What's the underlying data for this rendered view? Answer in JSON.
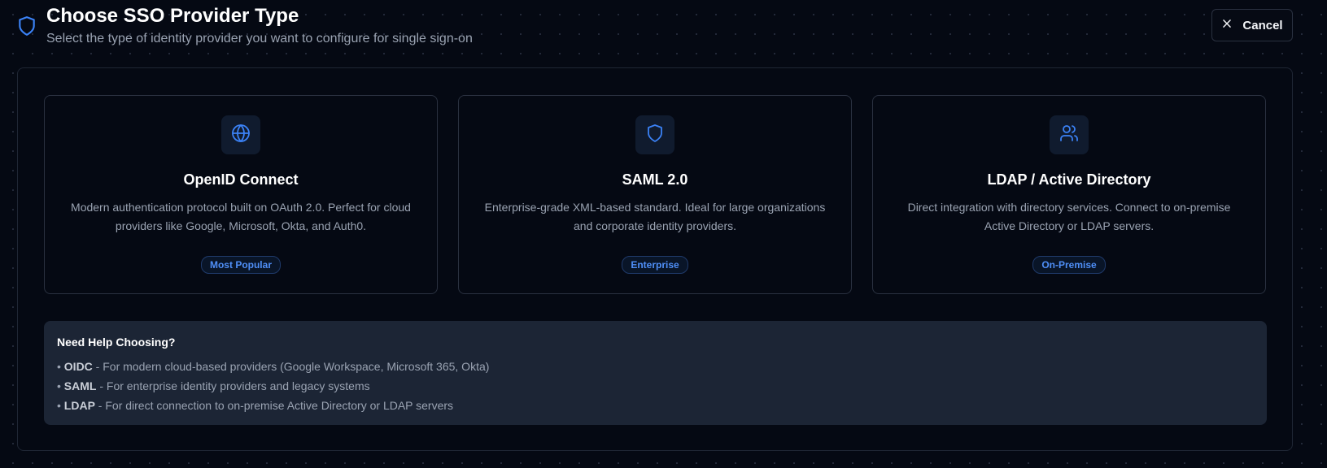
{
  "header": {
    "title": "Choose SSO Provider Type",
    "subtitle": "Select the type of identity provider you want to configure for single sign-on",
    "icon": "shield-icon",
    "cancel_label": "Cancel"
  },
  "providers": [
    {
      "icon": "globe-icon",
      "title": "OpenID Connect",
      "description": "Modern authentication protocol built on OAuth 2.0. Perfect for cloud providers like Google, Microsoft, Okta, and Auth0.",
      "badge": "Most Popular"
    },
    {
      "icon": "shield-icon",
      "title": "SAML 2.0",
      "description": "Enterprise-grade XML-based standard. Ideal for large organizations and corporate identity providers.",
      "badge": "Enterprise"
    },
    {
      "icon": "users-icon",
      "title": "LDAP / Active Directory",
      "description": "Direct integration with directory services. Connect to on-premise Active Directory or LDAP servers.",
      "badge": "On-Premise"
    }
  ],
  "help": {
    "title": "Need Help Choosing?",
    "bullet": "•",
    "items": [
      {
        "term": "OIDC",
        "text": " - For modern cloud-based providers (Google Workspace, Microsoft 365, Okta)"
      },
      {
        "term": "SAML",
        "text": " - For enterprise identity providers and legacy systems"
      },
      {
        "term": "LDAP",
        "text": " - For direct connection to on-premise Active Directory or LDAP servers"
      }
    ]
  },
  "colors": {
    "background": "#050913",
    "accent": "#3b82f6",
    "badge_text": "#4f8ff7",
    "help_background": "#1c2535"
  }
}
